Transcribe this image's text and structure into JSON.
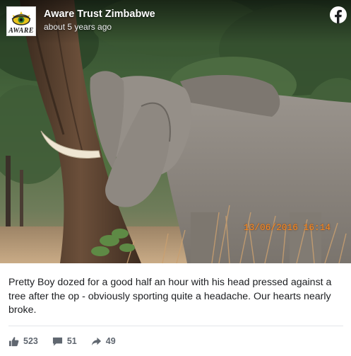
{
  "post": {
    "page_name": "Aware Trust Zimbabwe",
    "timestamp": "about 5 years ago",
    "avatar_brand": "AWARE",
    "photo_date_stamp": "13/06/2016 16:14",
    "caption": "Pretty Boy dozed for a good half an hour with his head pressed against a tree after the op - obviously sporting quite a headache. Our hearts nearly broke."
  },
  "stats": {
    "likes": "523",
    "comments": "51",
    "shares": "49"
  },
  "icons": {
    "platform": "facebook-icon",
    "like": "thumbs-up-icon",
    "comment": "speech-bubble-icon",
    "share": "share-arrow-icon"
  },
  "colors": {
    "stamp": "#ff8a1c",
    "text": "#1c1e21",
    "stat_text": "#606770"
  }
}
